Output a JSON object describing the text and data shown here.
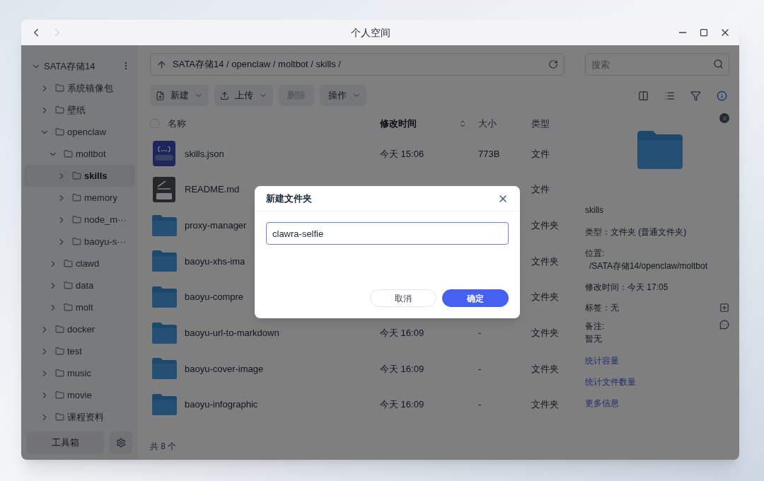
{
  "window": {
    "title": "个人空间"
  },
  "sidebar": {
    "tree": [
      {
        "label": "SATA存储14",
        "expanded": true,
        "selected": false,
        "children": [
          {
            "label": "系统镜像包",
            "expanded": false,
            "selected": false
          },
          {
            "label": "壁纸",
            "expanded": false,
            "selected": false
          },
          {
            "label": "openclaw",
            "expanded": true,
            "selected": false,
            "children": [
              {
                "label": "moltbot",
                "expanded": true,
                "selected": false,
                "children": [
                  {
                    "label": "skills",
                    "expanded": false,
                    "selected": true
                  },
                  {
                    "label": "memory",
                    "expanded": false,
                    "selected": false
                  },
                  {
                    "label": "node_m···",
                    "expanded": false,
                    "selected": false
                  },
                  {
                    "label": "baoyu-s···",
                    "expanded": false,
                    "selected": false
                  }
                ]
              },
              {
                "label": "clawd",
                "expanded": false,
                "selected": false
              },
              {
                "label": "data",
                "expanded": false,
                "selected": false
              },
              {
                "label": "molt",
                "expanded": false,
                "selected": false
              }
            ]
          },
          {
            "label": "docker",
            "expanded": false,
            "selected": false
          },
          {
            "label": "test",
            "expanded": false,
            "selected": false
          },
          {
            "label": "music",
            "expanded": false,
            "selected": false
          },
          {
            "label": "movie",
            "expanded": false,
            "selected": false
          },
          {
            "label": "课程资料",
            "expanded": false,
            "selected": false
          }
        ]
      }
    ],
    "toolbox_button": "工具箱"
  },
  "path": "SATA存储14 / openclaw / moltbot / skills /",
  "search": {
    "placeholder": "搜索"
  },
  "toolbar": [
    {
      "label": "新建",
      "kind": "new",
      "disabled": false,
      "menu": true
    },
    {
      "label": "上传",
      "kind": "upload",
      "disabled": false,
      "menu": true
    },
    {
      "label": "删除",
      "kind": "plain",
      "disabled": true,
      "menu": false
    },
    {
      "label": "操作",
      "kind": "plain",
      "disabled": false,
      "menu": true
    }
  ],
  "info_toggle": {
    "on": true
  },
  "table": {
    "select_all": {
      "checked": false
    },
    "columns": [
      {
        "label": "名称",
        "sorted": false
      },
      {
        "label": "修改时间",
        "sorted": true
      },
      {
        "label": "大小",
        "sorted": false
      },
      {
        "label": "类型",
        "sorted": false
      }
    ],
    "rows": [
      {
        "kind": "json",
        "name": "skills.json",
        "time": "今天 15:06",
        "size": "773B",
        "type": "文件"
      },
      {
        "kind": "md",
        "name": "README.md",
        "type": "文件"
      },
      {
        "kind": "folder",
        "name": "proxy-manager",
        "type": "文件夹"
      },
      {
        "kind": "folder",
        "name": "baoyu-xhs-ima",
        "type": "文件夹"
      },
      {
        "kind": "folder",
        "name": "baoyu-compre",
        "type": "文件夹"
      },
      {
        "kind": "folder",
        "name": "baoyu-url-to-markdown",
        "time": "今天 16:09",
        "size": "-",
        "type": "文件夹"
      },
      {
        "kind": "folder",
        "name": "baoyu-cover-image",
        "time": "今天 16:09",
        "size": "-",
        "type": "文件夹"
      },
      {
        "kind": "folder",
        "name": "baoyu-infographic",
        "time": "今天 16:09",
        "size": "-",
        "type": "文件夹"
      }
    ]
  },
  "status_bar": "共 8 个",
  "info": {
    "name": "skills",
    "type": "类型：文件夹 (普通文件夹)",
    "location_label": "位置:",
    "location": "/SATA存储14/openclaw/moltbot",
    "modified": "修改时间：今天 17:05",
    "tags": "标签：无",
    "note_label": "备注:",
    "note": "暂无",
    "links": [
      "统计容量",
      "统计文件数量",
      "更多信息"
    ]
  },
  "dialog": {
    "title": "新建文件夹",
    "value": "clawra-selfie",
    "cancel": "取消",
    "confirm": "确定"
  }
}
